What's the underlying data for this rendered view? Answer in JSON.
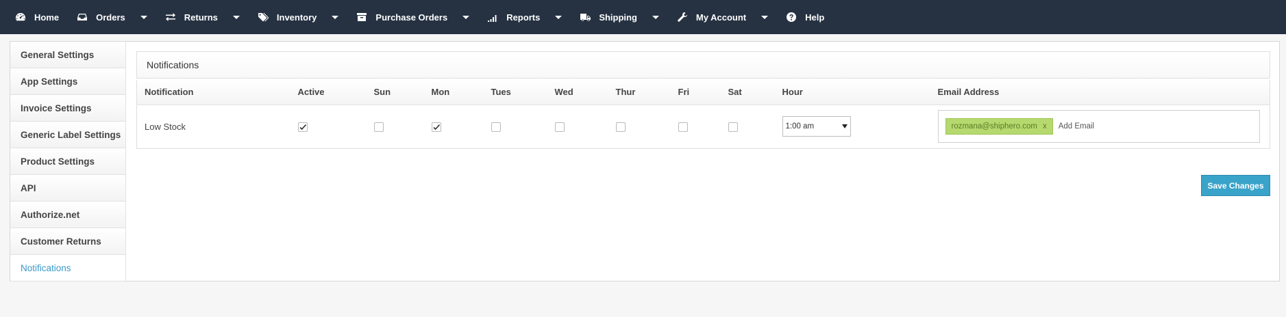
{
  "nav": {
    "items": [
      {
        "label": "Home",
        "icon": "dashboard-icon",
        "dropdown": false
      },
      {
        "label": "Orders",
        "icon": "inbox-icon",
        "dropdown": true
      },
      {
        "label": "Returns",
        "icon": "exchange-icon",
        "dropdown": true
      },
      {
        "label": "Inventory",
        "icon": "tags-icon",
        "dropdown": true
      },
      {
        "label": "Purchase Orders",
        "icon": "archive-icon",
        "dropdown": true
      },
      {
        "label": "Reports",
        "icon": "signal-icon",
        "dropdown": true
      },
      {
        "label": "Shipping",
        "icon": "truck-icon",
        "dropdown": true
      },
      {
        "label": "My Account",
        "icon": "wrench-icon",
        "dropdown": true
      },
      {
        "label": "Help",
        "icon": "question-circle-icon",
        "dropdown": false
      }
    ]
  },
  "sidebar": {
    "items": [
      {
        "label": "General Settings",
        "active": false
      },
      {
        "label": "App Settings",
        "active": false
      },
      {
        "label": "Invoice Settings",
        "active": false
      },
      {
        "label": "Generic Label Settings",
        "active": false
      },
      {
        "label": "Product Settings",
        "active": false
      },
      {
        "label": "API",
        "active": false
      },
      {
        "label": "Authorize.net",
        "active": false
      },
      {
        "label": "Customer Returns",
        "active": false
      },
      {
        "label": "Notifications",
        "active": true
      }
    ]
  },
  "panel": {
    "title": "Notifications"
  },
  "table": {
    "headers": {
      "notification": "Notification",
      "active": "Active",
      "sun": "Sun",
      "mon": "Mon",
      "tues": "Tues",
      "wed": "Wed",
      "thur": "Thur",
      "fri": "Fri",
      "sat": "Sat",
      "hour": "Hour",
      "email": "Email Address"
    },
    "row": {
      "name": "Low Stock",
      "active": true,
      "sun": false,
      "mon": true,
      "tues": false,
      "wed": false,
      "thur": false,
      "fri": false,
      "sat": false,
      "hour": "1:00 am",
      "email_tag": "rozmana@shiphero.com",
      "email_tag_remove": "x",
      "add_email_placeholder": "Add Email"
    }
  },
  "actions": {
    "save_label": "Save Changes"
  },
  "colors": {
    "nav_bg": "#263242",
    "accent": "#3aa3c9",
    "active_sidebar": "#3a99c9",
    "tag_bg": "#b6d96f"
  }
}
